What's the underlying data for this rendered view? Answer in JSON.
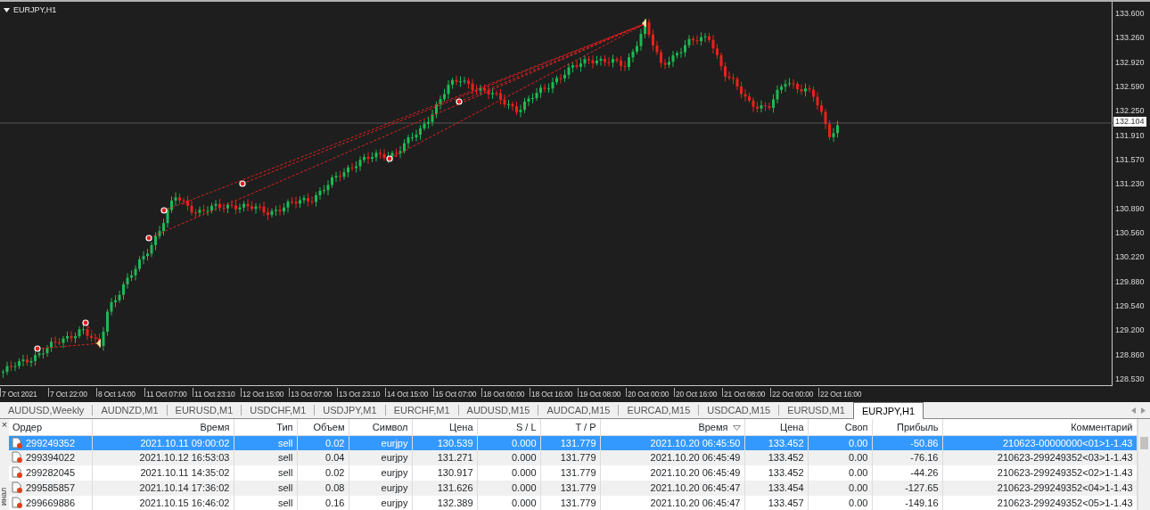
{
  "chart": {
    "title": "EURJPY,H1",
    "price_ticks": [
      "133.600",
      "133.260",
      "132.920",
      "132.590",
      "132.250",
      "131.910",
      "131.570",
      "131.230",
      "130.890",
      "130.560",
      "130.220",
      "129.880",
      "129.540",
      "129.200",
      "128.860",
      "128.530"
    ],
    "current_price": "132.104",
    "time_ticks": [
      "7 Oct 2021",
      "7 Oct 22:00",
      "8 Oct 14:00",
      "11 Oct 07:00",
      "11 Oct 23:10",
      "12 Oct 15:00",
      "13 Oct 07:00",
      "13 Oct 23:10",
      "14 Oct 15:00",
      "15 Oct 07:00",
      "18 Oct 00:00",
      "18 Oct 16:00",
      "19 Oct 08:00",
      "20 Oct 00:00",
      "20 Oct 16:00",
      "21 Oct 08:00",
      "22 Oct 00:00",
      "22 Oct 16:00"
    ]
  },
  "tabs": [
    {
      "label": "AUDUSD,Weekly",
      "selected": false
    },
    {
      "label": "AUDNZD,M1",
      "selected": false
    },
    {
      "label": "EURUSD,M1",
      "selected": false
    },
    {
      "label": "USDCHF,M1",
      "selected": false
    },
    {
      "label": "USDJPY,M1",
      "selected": false
    },
    {
      "label": "EURCHF,M1",
      "selected": false
    },
    {
      "label": "AUDUSD,M15",
      "selected": false
    },
    {
      "label": "AUDCAD,M15",
      "selected": false
    },
    {
      "label": "EURCAD,M15",
      "selected": false
    },
    {
      "label": "USDCAD,M15",
      "selected": false
    },
    {
      "label": "EURUSD,M1",
      "selected": false
    },
    {
      "label": "EURJPY,H1",
      "selected": true
    }
  ],
  "terminal": {
    "close": "×",
    "label": "инал",
    "columns": [
      {
        "label": "Ордер",
        "sorted": false
      },
      {
        "label": "Время",
        "sorted": false
      },
      {
        "label": "Тип",
        "sorted": false
      },
      {
        "label": "Объем",
        "sorted": false
      },
      {
        "label": "Символ",
        "sorted": false
      },
      {
        "label": "Цена",
        "sorted": false
      },
      {
        "label": "S / L",
        "sorted": false
      },
      {
        "label": "T / P",
        "sorted": false
      },
      {
        "label": "Время",
        "sorted": true
      },
      {
        "label": "Цена",
        "sorted": false
      },
      {
        "label": "Своп",
        "sorted": false
      },
      {
        "label": "Прибыль",
        "sorted": false
      },
      {
        "label": "Комментарий",
        "sorted": false
      }
    ],
    "rows": [
      {
        "selected": true,
        "cells": [
          "299249352",
          "2021.10.11 09:00:02",
          "sell",
          "0.02",
          "eurjpy",
          "130.539",
          "0.000",
          "131.779",
          "2021.10.20 06:45:50",
          "133.452",
          "0.00",
          "-50.86",
          "210623-00000000<01>1-1.43"
        ]
      },
      {
        "selected": false,
        "cells": [
          "299394022",
          "2021.10.12 16:53:03",
          "sell",
          "0.04",
          "eurjpy",
          "131.271",
          "0.000",
          "131.779",
          "2021.10.20 06:45:49",
          "133.452",
          "0.00",
          "-76.16",
          "210623-299249352<03>1-1.43"
        ]
      },
      {
        "selected": false,
        "cells": [
          "299282045",
          "2021.10.11 14:35:02",
          "sell",
          "0.02",
          "eurjpy",
          "130.917",
          "0.000",
          "131.779",
          "2021.10.20 06:45:49",
          "133.452",
          "0.00",
          "-44.26",
          "210623-299249352<02>1-1.43"
        ]
      },
      {
        "selected": false,
        "cells": [
          "299585857",
          "2021.10.14 17:36:02",
          "sell",
          "0.08",
          "eurjpy",
          "131.626",
          "0.000",
          "131.779",
          "2021.10.20 06:45:47",
          "133.454",
          "0.00",
          "-127.65",
          "210623-299249352<04>1-1.43"
        ]
      },
      {
        "selected": false,
        "cells": [
          "299669886",
          "2021.10.15 16:46:02",
          "sell",
          "0.16",
          "eurjpy",
          "132.389",
          "0.000",
          "131.779",
          "2021.10.20 06:45:47",
          "133.457",
          "0.00",
          "-149.16",
          "210623-299249352<05>1-1.43"
        ]
      }
    ]
  }
}
